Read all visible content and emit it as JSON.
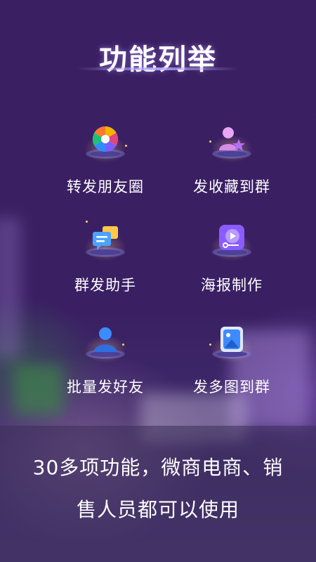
{
  "title": "功能列举",
  "features": [
    {
      "label": "转发朋友圈",
      "icon": "aperture-icon"
    },
    {
      "label": "发收藏到群",
      "icon": "user-star-icon"
    },
    {
      "label": "群发助手",
      "icon": "messages-icon"
    },
    {
      "label": "海报制作",
      "icon": "video-poster-icon"
    },
    {
      "label": "批量发好友",
      "icon": "user-icon"
    },
    {
      "label": "发多图到群",
      "icon": "image-icon"
    }
  ],
  "bottom": {
    "line1": "30多项功能，微商电商、销",
    "line2": "售人员都可以使用"
  },
  "colors": {
    "background": "#3a2060",
    "text": "#ffffff",
    "accent": "#7b5cff"
  }
}
